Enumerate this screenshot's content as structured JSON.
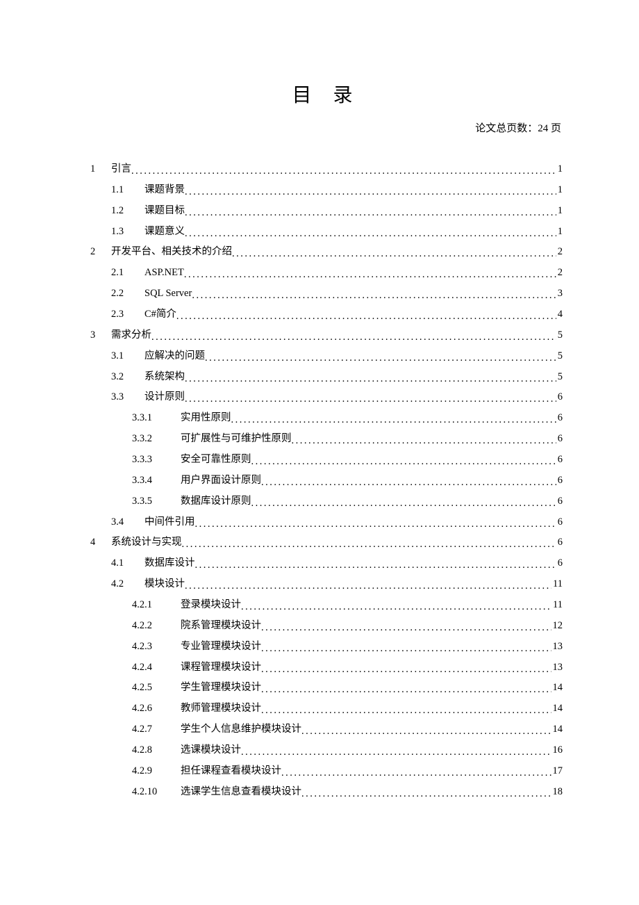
{
  "header": {
    "title": "目 录",
    "subtitle": "论文总页数：24 页"
  },
  "toc": [
    {
      "level": 1,
      "num": "1",
      "label": "引言",
      "page": "1"
    },
    {
      "level": 2,
      "num": "1.1",
      "label": "课题背景",
      "page": "1"
    },
    {
      "level": 2,
      "num": "1.2",
      "label": "课题目标",
      "page": "1"
    },
    {
      "level": 2,
      "num": "1.3",
      "label": "课题意义",
      "page": "1"
    },
    {
      "level": 1,
      "num": "2",
      "label": "开发平台、相关技术的介绍",
      "page": "2"
    },
    {
      "level": 2,
      "num": "2.1",
      "label": "ASP.NET",
      "page": "2"
    },
    {
      "level": 2,
      "num": "2.2",
      "label": "SQL Server",
      "page": "3"
    },
    {
      "level": 2,
      "num": "2.3",
      "label": "C#简介",
      "page": "4"
    },
    {
      "level": 1,
      "num": "3",
      "label": "需求分析",
      "page": "5"
    },
    {
      "level": 2,
      "num": "3.1",
      "label": "应解决的问题",
      "page": "5"
    },
    {
      "level": 2,
      "num": "3.2",
      "label": "系统架构",
      "page": "5"
    },
    {
      "level": 2,
      "num": "3.3",
      "label": "设计原则",
      "page": "6"
    },
    {
      "level": 3,
      "num": "3.3.1",
      "label": "实用性原则",
      "page": "6"
    },
    {
      "level": 3,
      "num": "3.3.2",
      "label": "可扩展性与可维护性原则",
      "page": "6"
    },
    {
      "level": 3,
      "num": "3.3.3",
      "label": "安全可靠性原则",
      "page": "6"
    },
    {
      "level": 3,
      "num": "3.3.4",
      "label": "用户界面设计原则",
      "page": "6"
    },
    {
      "level": 3,
      "num": "3.3.5",
      "label": "数据库设计原则",
      "page": "6"
    },
    {
      "level": 2,
      "num": "3.4",
      "label": "中间件引用",
      "page": "6"
    },
    {
      "level": 1,
      "num": "4",
      "label": "系统设计与实现",
      "page": "6"
    },
    {
      "level": 2,
      "num": "4.1",
      "label": "数据库设计",
      "page": "6"
    },
    {
      "level": 2,
      "num": "4.2",
      "label": "模块设计",
      "page": "11"
    },
    {
      "level": 3,
      "num": "4.2.1",
      "label": "登录模块设计",
      "page": "11"
    },
    {
      "level": 3,
      "num": "4.2.2",
      "label": "院系管理模块设计",
      "page": "12"
    },
    {
      "level": 3,
      "num": "4.2.3",
      "label": "专业管理模块设计",
      "page": "13"
    },
    {
      "level": 3,
      "num": "4.2.4",
      "label": "课程管理模块设计",
      "page": "13"
    },
    {
      "level": 3,
      "num": "4.2.5",
      "label": "学生管理模块设计",
      "page": "14"
    },
    {
      "level": 3,
      "num": "4.2.6",
      "label": "教师管理模块设计",
      "page": "14"
    },
    {
      "level": 3,
      "num": "4.2.7",
      "label": "学生个人信息维护模块设计",
      "page": "14"
    },
    {
      "level": 3,
      "num": "4.2.8",
      "label": "选课模块设计",
      "page": "16"
    },
    {
      "level": 3,
      "num": "4.2.9",
      "label": "担任课程查看模块设计",
      "page": "17"
    },
    {
      "level": 3,
      "num": "4.2.10",
      "label": "选课学生信息查看模块设计",
      "page": "18"
    }
  ]
}
